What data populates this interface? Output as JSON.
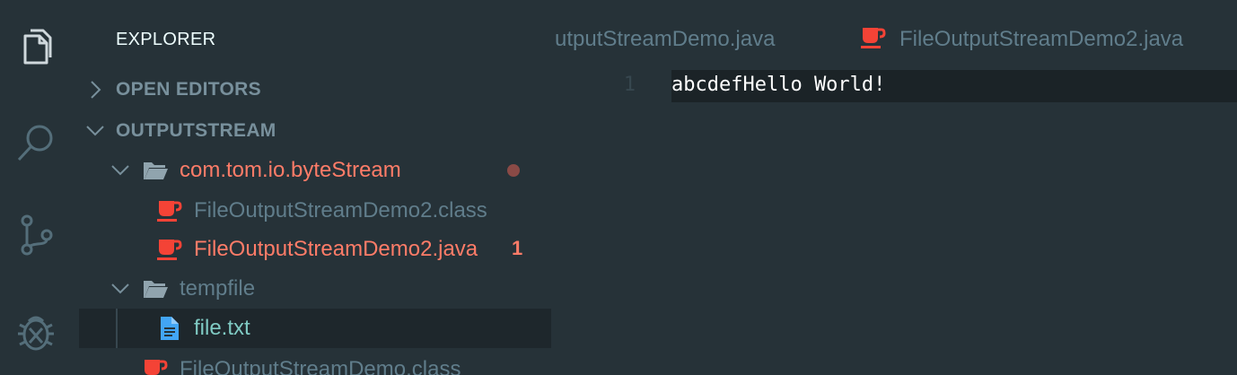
{
  "activity_bar": {
    "icons": [
      "files-icon",
      "search-icon",
      "source-control-icon",
      "debug-icon"
    ]
  },
  "explorer": {
    "title": "EXPLORER",
    "open_editors_label": "OPEN EDITORS",
    "workspace_label": "OUTPUTSTREAM",
    "tree": [
      {
        "label": "com.tom.io.byteStream",
        "type": "folder",
        "expanded": true,
        "status": "modified"
      },
      {
        "label": "FileOutputStreamDemo2.class",
        "type": "java-file",
        "status": "normal"
      },
      {
        "label": "FileOutputStreamDemo2.java",
        "type": "java-file",
        "status": "modified",
        "badge": "1"
      },
      {
        "label": "tempfile",
        "type": "folder",
        "expanded": true,
        "status": "normal"
      },
      {
        "label": "file.txt",
        "type": "text-file",
        "status": "selected"
      },
      {
        "label": "FileOutputStreamDemo.class",
        "type": "java-file",
        "status": "normal"
      }
    ]
  },
  "tabs": [
    {
      "label": "utputStreamDemo.java",
      "icon": "java-icon"
    },
    {
      "label": "FileOutputStreamDemo2.java",
      "icon": "java-icon"
    }
  ],
  "editor": {
    "line_numbers": [
      "1"
    ],
    "lines": [
      "abcdefHello World!"
    ]
  },
  "colors": {
    "background": "#263238",
    "modified": "#ff7c68",
    "active": "#80cbc4",
    "muted": "#607d8b",
    "java_icon": "#f44336",
    "text_icon": "#42a5f5"
  }
}
